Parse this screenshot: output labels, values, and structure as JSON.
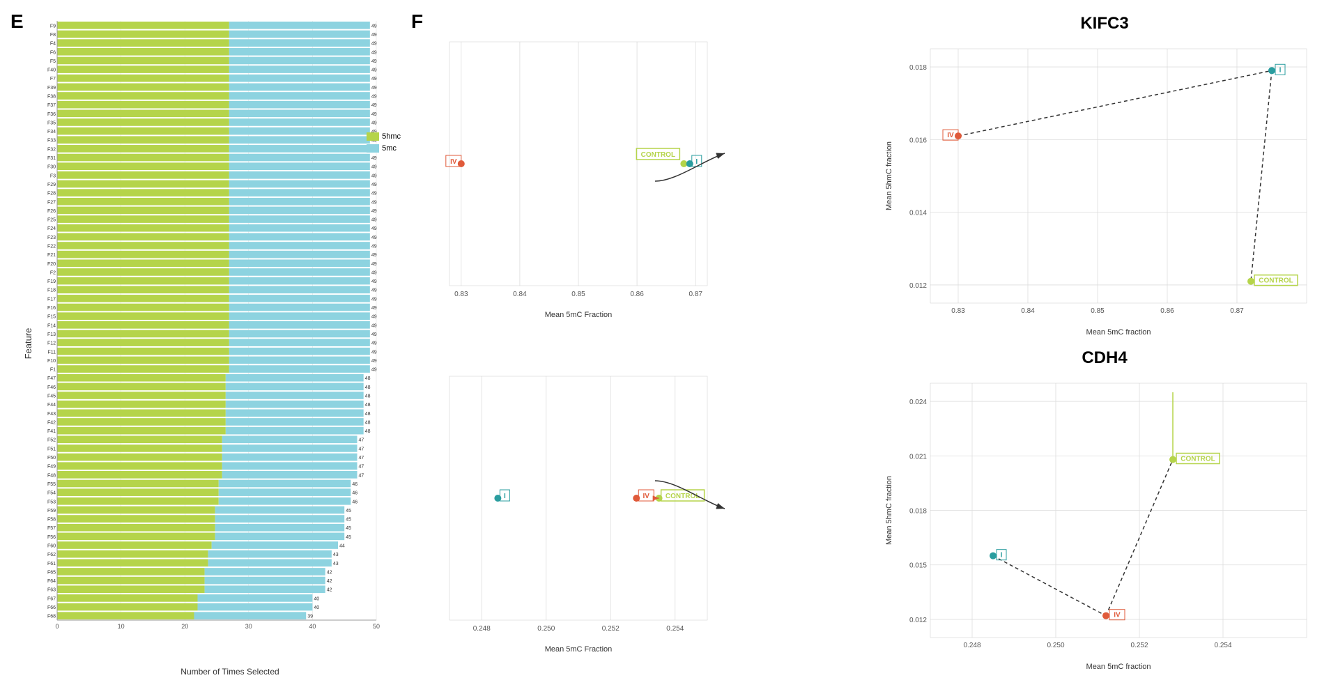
{
  "panels": {
    "e_label": "E",
    "f_label": "F"
  },
  "bar_chart": {
    "x_label": "Number of Times Selected",
    "y_label": "Feature",
    "x_ticks": [
      "0",
      "10",
      "20",
      "30",
      "40",
      "50"
    ],
    "legend": {
      "color_5hmc": "#b5d44a",
      "color_5mc": "#8dd3e0",
      "label_5hmc": "5hmc",
      "label_5mc": "5mc"
    },
    "bars": [
      {
        "label": "F9",
        "value": 49
      },
      {
        "label": "F8",
        "value": 49
      },
      {
        "label": "F4",
        "value": 49
      },
      {
        "label": "F6",
        "value": 49
      },
      {
        "label": "F5",
        "value": 49
      },
      {
        "label": "F40",
        "value": 49
      },
      {
        "label": "F7",
        "value": 49
      },
      {
        "label": "F39",
        "value": 49
      },
      {
        "label": "F38",
        "value": 49
      },
      {
        "label": "F37",
        "value": 49
      },
      {
        "label": "F36",
        "value": 49
      },
      {
        "label": "F35",
        "value": 49
      },
      {
        "label": "F34",
        "value": 49
      },
      {
        "label": "F33",
        "value": 49
      },
      {
        "label": "F32",
        "value": 49
      },
      {
        "label": "F31",
        "value": 49
      },
      {
        "label": "F30",
        "value": 49
      },
      {
        "label": "F3",
        "value": 49
      },
      {
        "label": "F29",
        "value": 49
      },
      {
        "label": "F28",
        "value": 49
      },
      {
        "label": "F27",
        "value": 49
      },
      {
        "label": "F26",
        "value": 49
      },
      {
        "label": "F25",
        "value": 49
      },
      {
        "label": "F24",
        "value": 49
      },
      {
        "label": "F23",
        "value": 49
      },
      {
        "label": "F22",
        "value": 49
      },
      {
        "label": "F21",
        "value": 49
      },
      {
        "label": "F20",
        "value": 49
      },
      {
        "label": "F2",
        "value": 49
      },
      {
        "label": "F19",
        "value": 49
      },
      {
        "label": "F18",
        "value": 49
      },
      {
        "label": "F17",
        "value": 49
      },
      {
        "label": "F16",
        "value": 49
      },
      {
        "label": "F15",
        "value": 49
      },
      {
        "label": "F14",
        "value": 49
      },
      {
        "label": "F13",
        "value": 49
      },
      {
        "label": "F12",
        "value": 49
      },
      {
        "label": "F11",
        "value": 49
      },
      {
        "label": "F10",
        "value": 49
      },
      {
        "label": "F1",
        "value": 49
      },
      {
        "label": "F47",
        "value": 48
      },
      {
        "label": "F46",
        "value": 48
      },
      {
        "label": "F45",
        "value": 48
      },
      {
        "label": "F44",
        "value": 48
      },
      {
        "label": "F43",
        "value": 48
      },
      {
        "label": "F42",
        "value": 48
      },
      {
        "label": "F41",
        "value": 48
      },
      {
        "label": "F52",
        "value": 47
      },
      {
        "label": "F51",
        "value": 47
      },
      {
        "label": "F50",
        "value": 47
      },
      {
        "label": "F49",
        "value": 47
      },
      {
        "label": "F48",
        "value": 47
      },
      {
        "label": "F55",
        "value": 46
      },
      {
        "label": "F54",
        "value": 46
      },
      {
        "label": "F53",
        "value": 46
      },
      {
        "label": "F59",
        "value": 45
      },
      {
        "label": "F58",
        "value": 45
      },
      {
        "label": "F57",
        "value": 45
      },
      {
        "label": "F56",
        "value": 45
      },
      {
        "label": "F60",
        "value": 44
      },
      {
        "label": "F62",
        "value": 43
      },
      {
        "label": "F61",
        "value": 43
      },
      {
        "label": "F65",
        "value": 42
      },
      {
        "label": "F64",
        "value": 42
      },
      {
        "label": "F63",
        "value": 42
      },
      {
        "label": "F67",
        "value": 40
      },
      {
        "label": "F66",
        "value": 40
      },
      {
        "label": "F68",
        "value": 39
      }
    ]
  },
  "scatter_top": {
    "x_label": "Mean 5mC Fraction",
    "x_ticks": [
      "0.83",
      "0.84",
      "0.85",
      "0.86",
      "0.87"
    ],
    "points": [
      {
        "group": "IV",
        "x": 0.83,
        "y": 0
      },
      {
        "group": "I",
        "x": 0.869,
        "y": 0
      },
      {
        "group": "CONTROL",
        "x": 0.868,
        "y": 0
      }
    ]
  },
  "scatter_bottom": {
    "x_label": "Mean 5mC Fraction",
    "x_ticks": [
      "0.248",
      "0.250",
      "0.252",
      "0.254"
    ],
    "points": [
      {
        "group": "I",
        "x": 0.248,
        "y": 0
      },
      {
        "group": "IV",
        "x": 0.253,
        "y": 0
      },
      {
        "group": "CONTROL",
        "x": 0.254,
        "y": 0
      }
    ]
  },
  "kifc3": {
    "title": "KIFC3",
    "x_label": "Mean 5mC fraction",
    "y_label": "Mean 5hmC fraction",
    "x_ticks": [
      "0.83",
      "0.84",
      "0.85",
      "0.86",
      "0.87"
    ],
    "y_ticks": [
      "0.012",
      "0.014",
      "0.016",
      "0.018"
    ],
    "points": [
      {
        "group": "IV",
        "x": 0.83,
        "y": 0.0161
      },
      {
        "group": "I",
        "x": 0.875,
        "y": 0.0179
      },
      {
        "group": "CONTROL",
        "x": 0.872,
        "y": 0.0121
      }
    ]
  },
  "cdh4": {
    "title": "CDH4",
    "x_label": "Mean 5mC fraction",
    "y_label": "Mean 5hmC fraction",
    "x_ticks": [
      "0.248",
      "0.250",
      "0.252",
      "0.254"
    ],
    "y_ticks": [
      "0.012",
      "0.015",
      "0.018",
      "0.021",
      "0.024"
    ],
    "points": [
      {
        "group": "IV",
        "x": 0.2512,
        "y": 0.0122
      },
      {
        "group": "I",
        "x": 0.2485,
        "y": 0.0155
      },
      {
        "group": "CONTROL",
        "x": 0.2528,
        "y": 0.0208
      }
    ]
  },
  "colors": {
    "green": "#b5d44a",
    "teal": "#2a9d9f",
    "orange": "#e05a3a",
    "grid": "#e0e0e0",
    "axis": "#999"
  }
}
